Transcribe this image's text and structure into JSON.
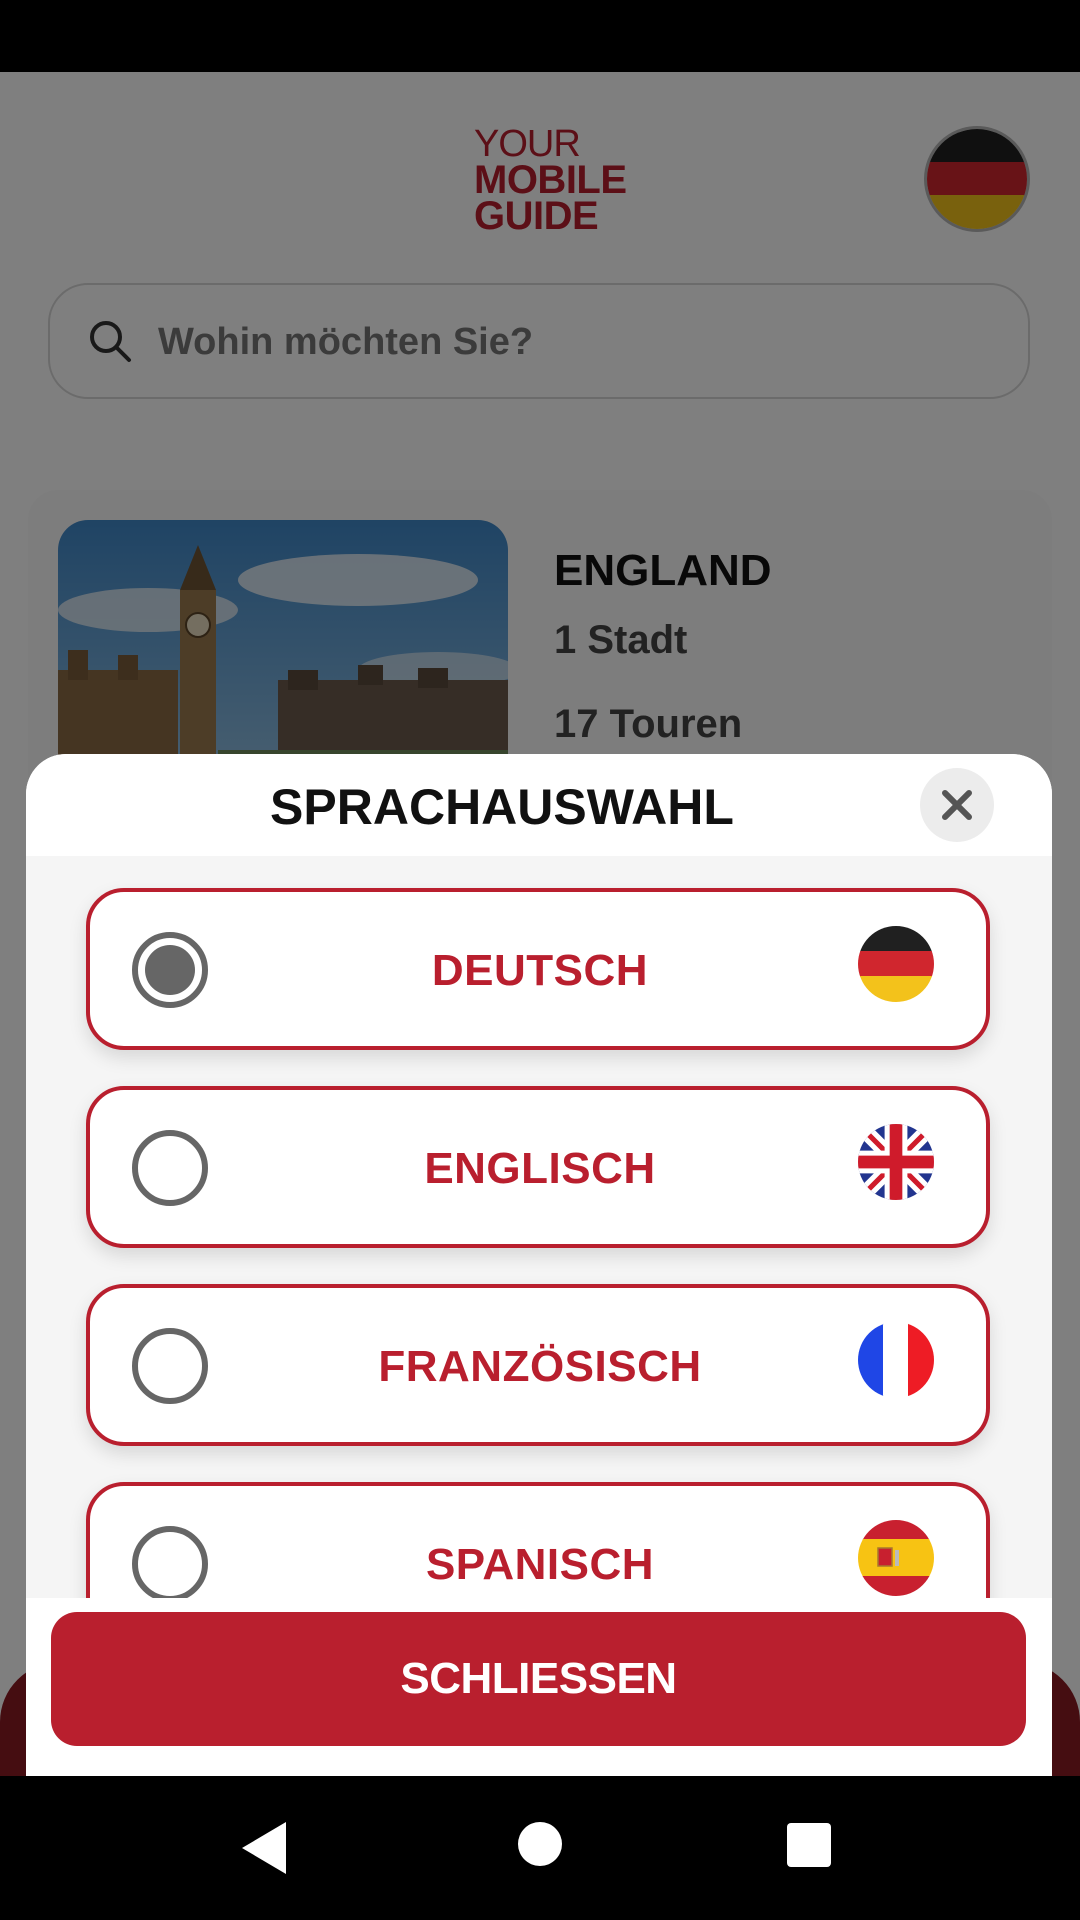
{
  "app": {
    "logo": {
      "line1": "YOUR",
      "line2": "MOBILE",
      "line3": "GUIDE"
    },
    "header_flag_icon": "germany-flag-icon"
  },
  "search": {
    "placeholder": "Wohin möchten Sie?",
    "value": "",
    "icon": "search-icon"
  },
  "country_card": {
    "name": "ENGLAND",
    "cities": "1 Stadt",
    "tours": "17 Touren"
  },
  "language_modal": {
    "title": "SPRACHAUSWAHL",
    "close_icon": "close-icon",
    "options": [
      {
        "label": "DEUTSCH",
        "selected": true,
        "flag": "germany-flag-icon"
      },
      {
        "label": "ENGLISCH",
        "selected": false,
        "flag": "uk-flag-icon"
      },
      {
        "label": "FRANZÖSISCH",
        "selected": false,
        "flag": "france-flag-icon"
      },
      {
        "label": "SPANISCH",
        "selected": false,
        "flag": "spain-flag-icon"
      }
    ],
    "confirm_label": "SCHLIESSEN"
  },
  "colors": {
    "brand_red": "#b91f2e",
    "german_black": "#202020",
    "german_red": "#d0262e",
    "german_gold": "#f3c21b"
  },
  "system_nav": {
    "back": "back-icon",
    "home": "home-icon",
    "recents": "recents-icon"
  }
}
